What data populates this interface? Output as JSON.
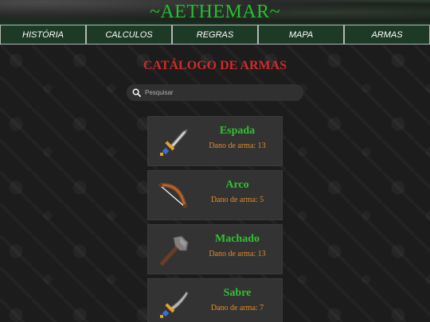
{
  "site": {
    "title": "~AETHEMAR~"
  },
  "nav": {
    "items": [
      {
        "label": "HISTÓRIA"
      },
      {
        "label": "CALCULOS"
      },
      {
        "label": "REGRAS"
      },
      {
        "label": "MAPA"
      },
      {
        "label": "ARMAS"
      }
    ]
  },
  "main": {
    "title": "CATÁLOGO DE ARMAS",
    "search": {
      "placeholder": "Pesquisar"
    },
    "weapons": [
      {
        "name": "Espada",
        "damage": "Dano de arma: 13",
        "icon": "sword-icon"
      },
      {
        "name": "Arco",
        "damage": "Dano de arma: 5",
        "icon": "bow-icon"
      },
      {
        "name": "Machado",
        "damage": "Dano de arma: 13",
        "icon": "axe-icon"
      },
      {
        "name": "Sabre",
        "damage": "Dano de arma: 7",
        "icon": "saber-icon"
      }
    ]
  },
  "colors": {
    "title_green": "#21c22a",
    "heading_red": "#cf2a2a",
    "name_green": "#2fc22f",
    "damage_orange": "#e08a2a",
    "nav_bg": "#1d3a26"
  }
}
